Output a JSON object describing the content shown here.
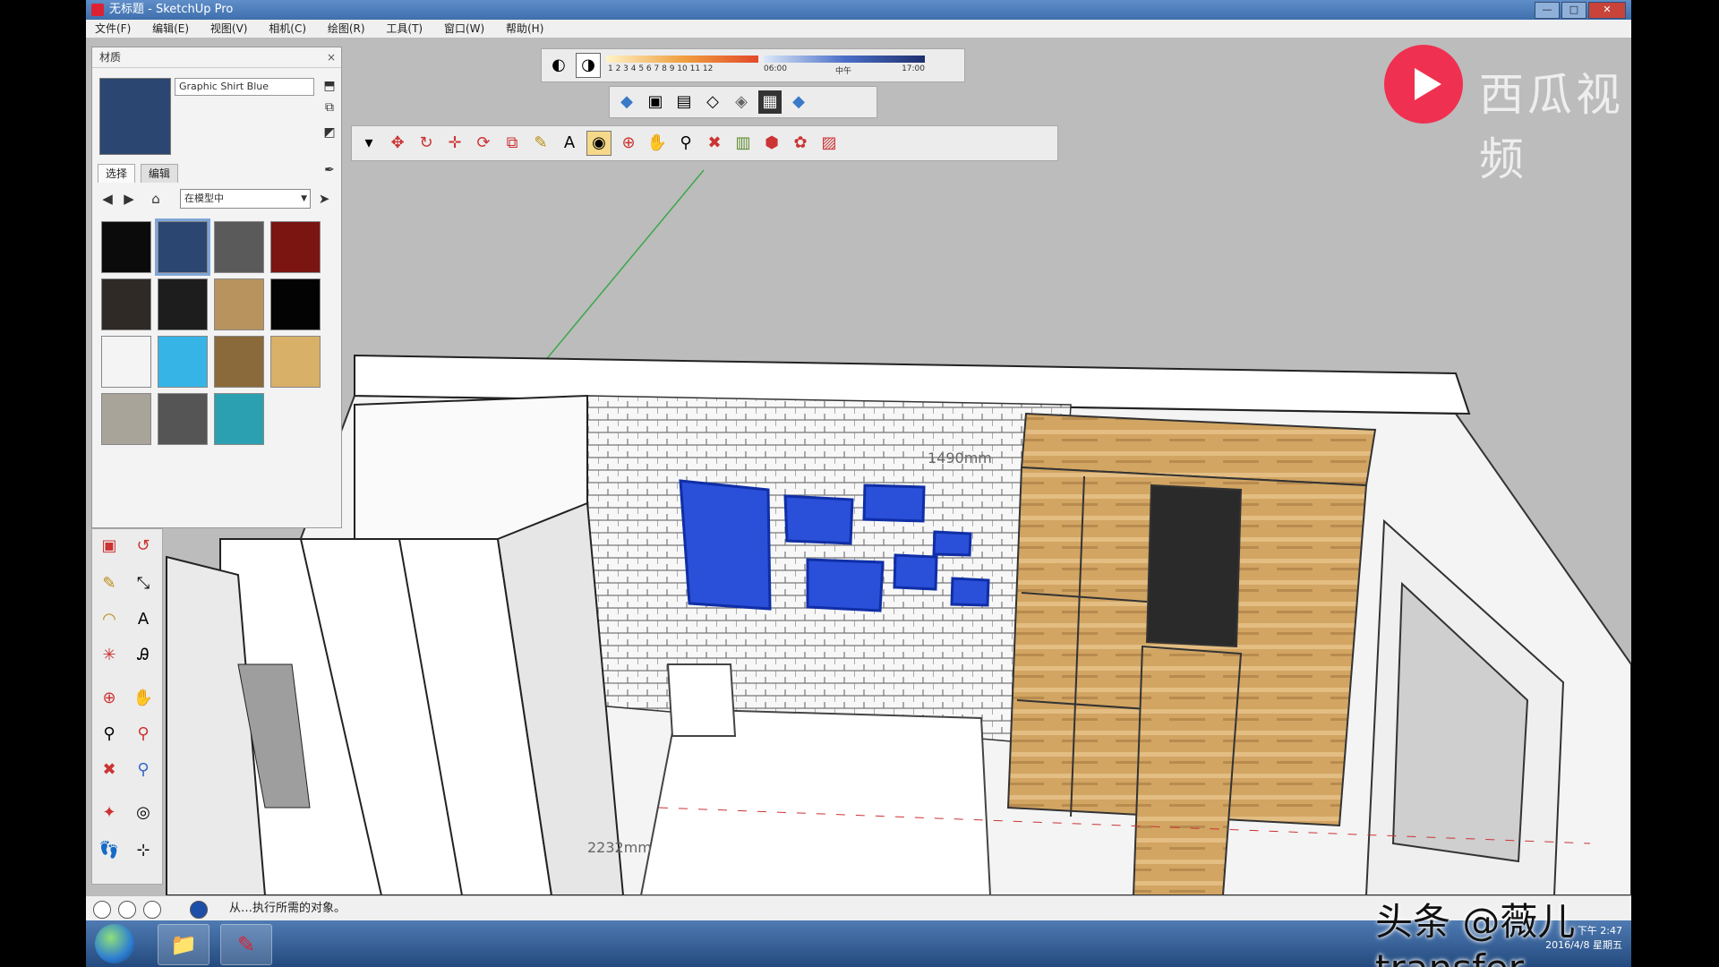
{
  "window": {
    "title": "无标题 - SketchUp Pro",
    "controls": [
      "—",
      "□",
      "✕"
    ]
  },
  "menu": [
    "文件(F)",
    "编辑(E)",
    "视图(V)",
    "相机(C)",
    "绘图(R)",
    "工具(T)",
    "窗口(W)",
    "帮助(H)"
  ],
  "material_panel": {
    "title": "材质",
    "close": "×",
    "current_material": "Graphic Shirt Blue",
    "tabs": [
      "选择",
      "编辑"
    ],
    "collection": "在模型中",
    "swatches": [
      "#0b0b0b",
      "#2b4670",
      "#5a5a5a",
      "#7a1512",
      "#2f2a26",
      "#1d1d1d",
      "#b8935e",
      "#030303",
      "#f4f4f4",
      "#37b4e6",
      "#8a6a3a",
      "#d9b068",
      "#a9a49a",
      "#555555",
      "#2aa0b0"
    ]
  },
  "shadow_bar": {
    "months": "1 2 3 4 5 6 7 8 9 10 11 12",
    "time_start": "06:00",
    "time_mid": "中午",
    "time_end": "17:00"
  },
  "viewport": {
    "dimension_top": "1490mm",
    "dimension_bottom": "2232mm"
  },
  "status": {
    "hint": "从…执行所需的对象。"
  },
  "tray": {
    "time": "下午 2:47",
    "date": "2016/4/8 星期五"
  },
  "watermarks": {
    "top_brand": "西瓜视频",
    "bottom": "头条 @薇儿transfer"
  },
  "colors": {
    "blue_frames": "#2a4fd8",
    "wood": "#d4a968",
    "selected_material": "#2b4670"
  }
}
